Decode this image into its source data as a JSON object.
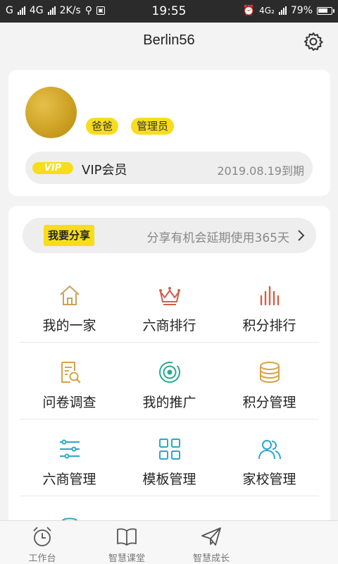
{
  "status_bar": {
    "left": [
      "G",
      "4G",
      "2K/s"
    ],
    "time": "19:55",
    "network": "4G₂",
    "battery": "79%",
    "battery_level": 0.79
  },
  "header": {
    "title": "Berlin56",
    "settings_icon": "gear-icon"
  },
  "profile": {
    "tags": [
      "爸爸",
      "管理员"
    ],
    "vip_badge": "VIP",
    "vip_label": "VIP会员",
    "vip_expiry": "2019.08.19到期"
  },
  "share": {
    "button_label": "我要分享",
    "text": "分享有机会延期使用365天",
    "chevron_icon": "chevron-right-icon"
  },
  "menu": {
    "items": [
      {
        "label": "我的一家",
        "icon": "home-icon",
        "color": "#c9a15a"
      },
      {
        "label": "六商排行",
        "icon": "crown-icon",
        "color": "#d0604a"
      },
      {
        "label": "积分排行",
        "icon": "bar-chart-icon",
        "color": "#d0604a"
      },
      {
        "label": "问卷调查",
        "icon": "survey-icon",
        "color": "#d6a447"
      },
      {
        "label": "我的推广",
        "icon": "target-icon",
        "color": "#2aa892"
      },
      {
        "label": "积分管理",
        "icon": "coins-icon",
        "color": "#d6a447"
      },
      {
        "label": "六商管理",
        "icon": "sliders-icon",
        "color": "#2ea6c9"
      },
      {
        "label": "模板管理",
        "icon": "grid-icon",
        "color": "#2ea6c9"
      },
      {
        "label": "家校管理",
        "icon": "users-icon",
        "color": "#2ea6c9"
      }
    ]
  },
  "bottom_nav": [
    {
      "label": "工作台",
      "icon": "alarm-clock-icon"
    },
    {
      "label": "智慧课堂",
      "icon": "book-icon"
    },
    {
      "label": "智慧成长",
      "icon": "paper-plane-icon"
    }
  ],
  "colors": {
    "accent": "#f7dd1c",
    "background": "#f3f3f3",
    "status_bar": "#2b2b2b"
  }
}
